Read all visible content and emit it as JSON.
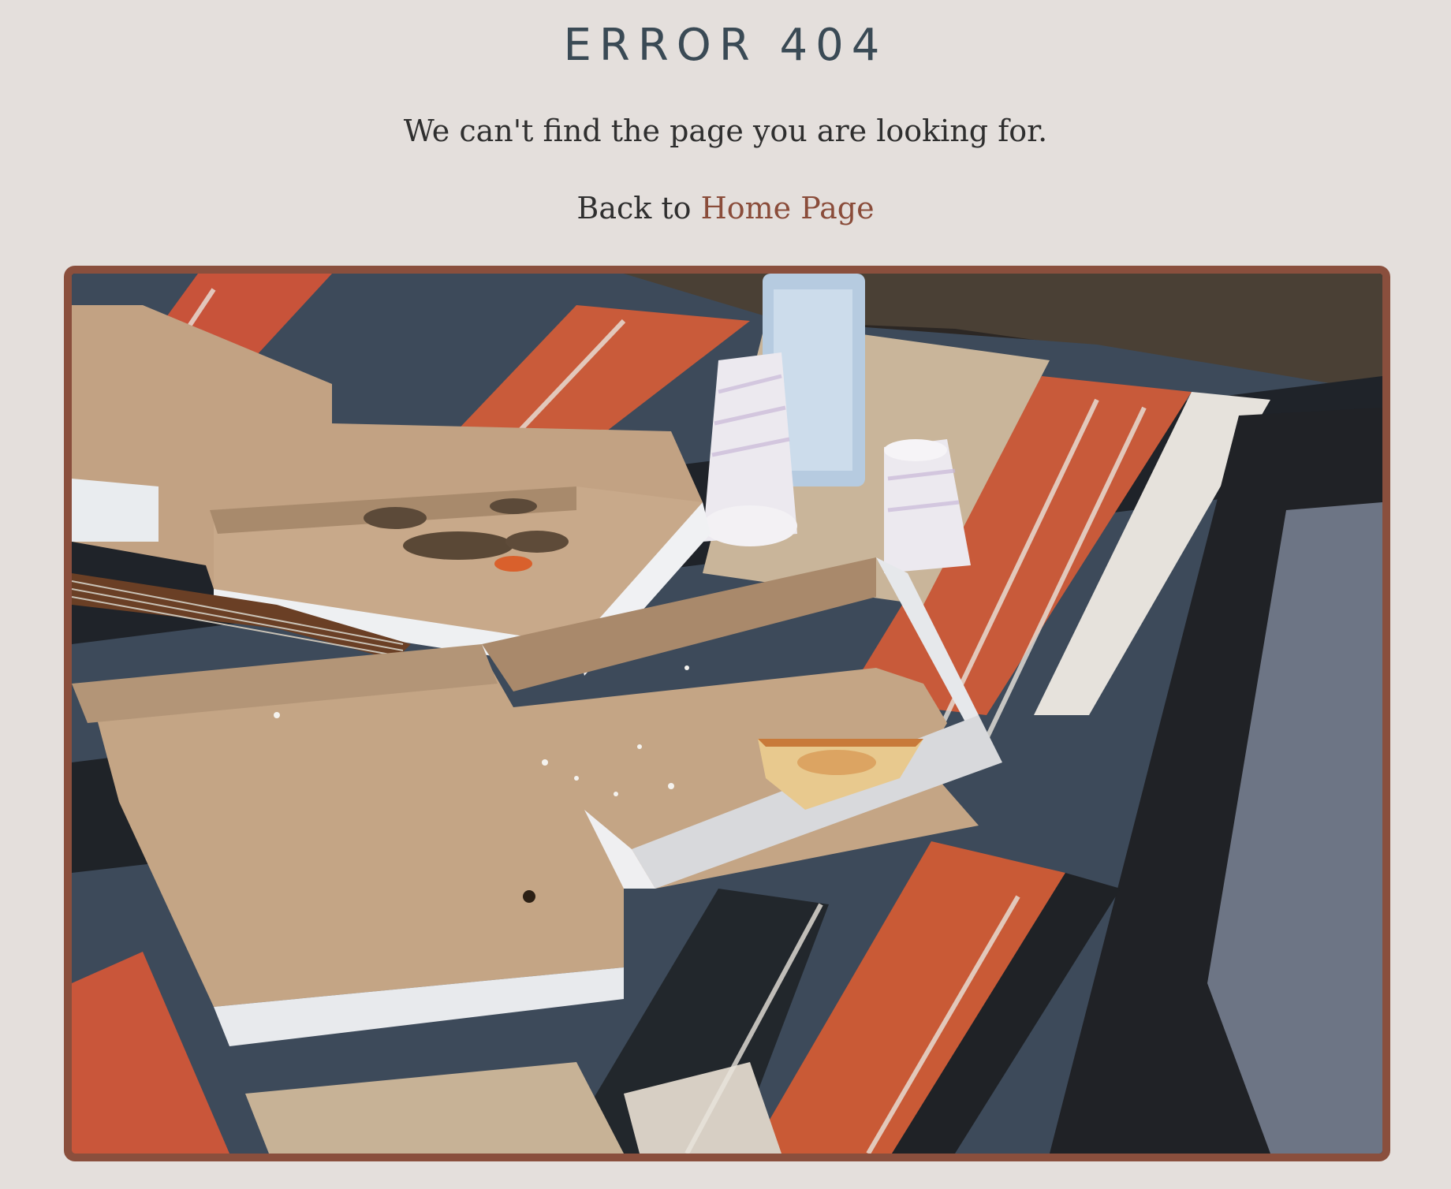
{
  "page": {
    "title": "ERROR 404",
    "message": "We can't find the page you are looking for.",
    "back_prefix": "Back to ",
    "home_link": "Home Page"
  },
  "colors": {
    "background": "#e4dfdc",
    "title": "#3a4a55",
    "link": "#8a4c3a",
    "frame_border": "#8a4f3d"
  },
  "image": {
    "description_icon": "picnic-photo"
  }
}
